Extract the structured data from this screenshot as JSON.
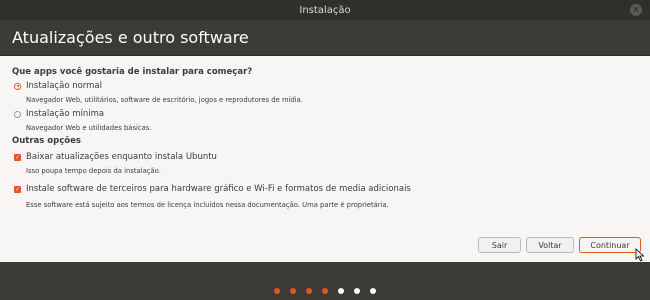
{
  "window": {
    "title": "Instalação",
    "close_glyph": "×"
  },
  "header": {
    "title": "Atualizações e outro software"
  },
  "install_type": {
    "question": "Que apps você gostaria de instalar para começar?",
    "options": [
      {
        "label": "Instalação normal",
        "description": "Navegador Web, utilitários, software de escritório, jogos e reprodutores de mídia.",
        "selected": true
      },
      {
        "label": "Instalação mínima",
        "description": "Navegador Web e utilidades básicas.",
        "selected": false
      }
    ]
  },
  "other_options": {
    "title": "Outras opções",
    "items": [
      {
        "label": "Baixar atualizações enquanto instala Ubuntu",
        "description": "Isso poupa tempo depois da instalação.",
        "checked": true
      },
      {
        "label": "Instale software de terceiros para hardware gráfico e Wi-Fi e formatos de media adicionais",
        "description": "Esse software está sujeito aos termos de licença incluídos nessa documentação. Uma parte é proprietária.",
        "checked": true
      }
    ]
  },
  "buttons": {
    "quit": "Sair",
    "back": "Voltar",
    "continue": "Continuar"
  },
  "progress": {
    "total_steps": 7,
    "completed_steps": 4,
    "active_color": "#e95420",
    "inactive_color": "#ffffff"
  },
  "colors": {
    "accent": "#e95420",
    "chrome": "#3c3b37",
    "panel": "#f7f6f5"
  },
  "icons": {
    "check": "checkmark-icon",
    "cursor": "mouse-pointer-icon"
  }
}
